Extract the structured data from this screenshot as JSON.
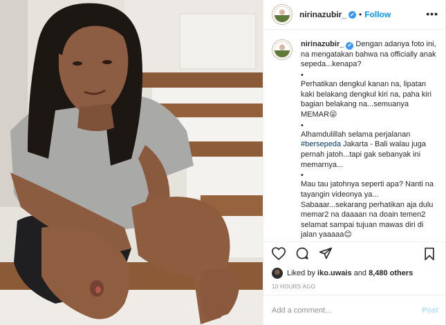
{
  "header": {
    "username": "nirinazubir_",
    "separator": "•",
    "follow_label": "Follow",
    "more_label": "•••"
  },
  "caption": {
    "username": "nirinazubir_",
    "para1": "Dengan adanya foto ini, na mengatakan bahwa na officially anak sepeda...kenapa?",
    "para2": "Perhatikan dengkul kanan na, lipatan kaki belakang dengkul kiri na, paha kiri bagian belakang na...semuanya MEMAR😜",
    "para3_before": "Alhamdulillah selama perjalanan ",
    "hashtag": "#bersepeda",
    "para3_after": " Jakarta - Bali walau juga pernah jatoh...tapi gak sebanyak ini memarnya...",
    "para4": "Mau tau jatohnya seperti apa? Nanti na tayangin videonya ya... Sabaaar...sekarang perhatikan aja dulu memar2 na daaaan na doain temen2 selamat sampai tujuan mawas diri di jalan yaaaaa😊",
    "bullet": "•"
  },
  "likes": {
    "prefix": "Liked by ",
    "user": "iko.uwais",
    "middle": " and ",
    "count": "8,480 others"
  },
  "timestamp": "10 HOURS AGO",
  "comment_box": {
    "placeholder": "Add a comment...",
    "post_label": "Post"
  },
  "icons": {
    "verified": "verified-badge-icon",
    "like": "heart-icon",
    "comment": "comment-icon",
    "share": "share-icon",
    "save": "bookmark-icon"
  },
  "colors": {
    "link": "#0095f6",
    "verified": "#3897f0",
    "muted": "#8e8e8e",
    "post_disabled": "#b2dffc"
  }
}
